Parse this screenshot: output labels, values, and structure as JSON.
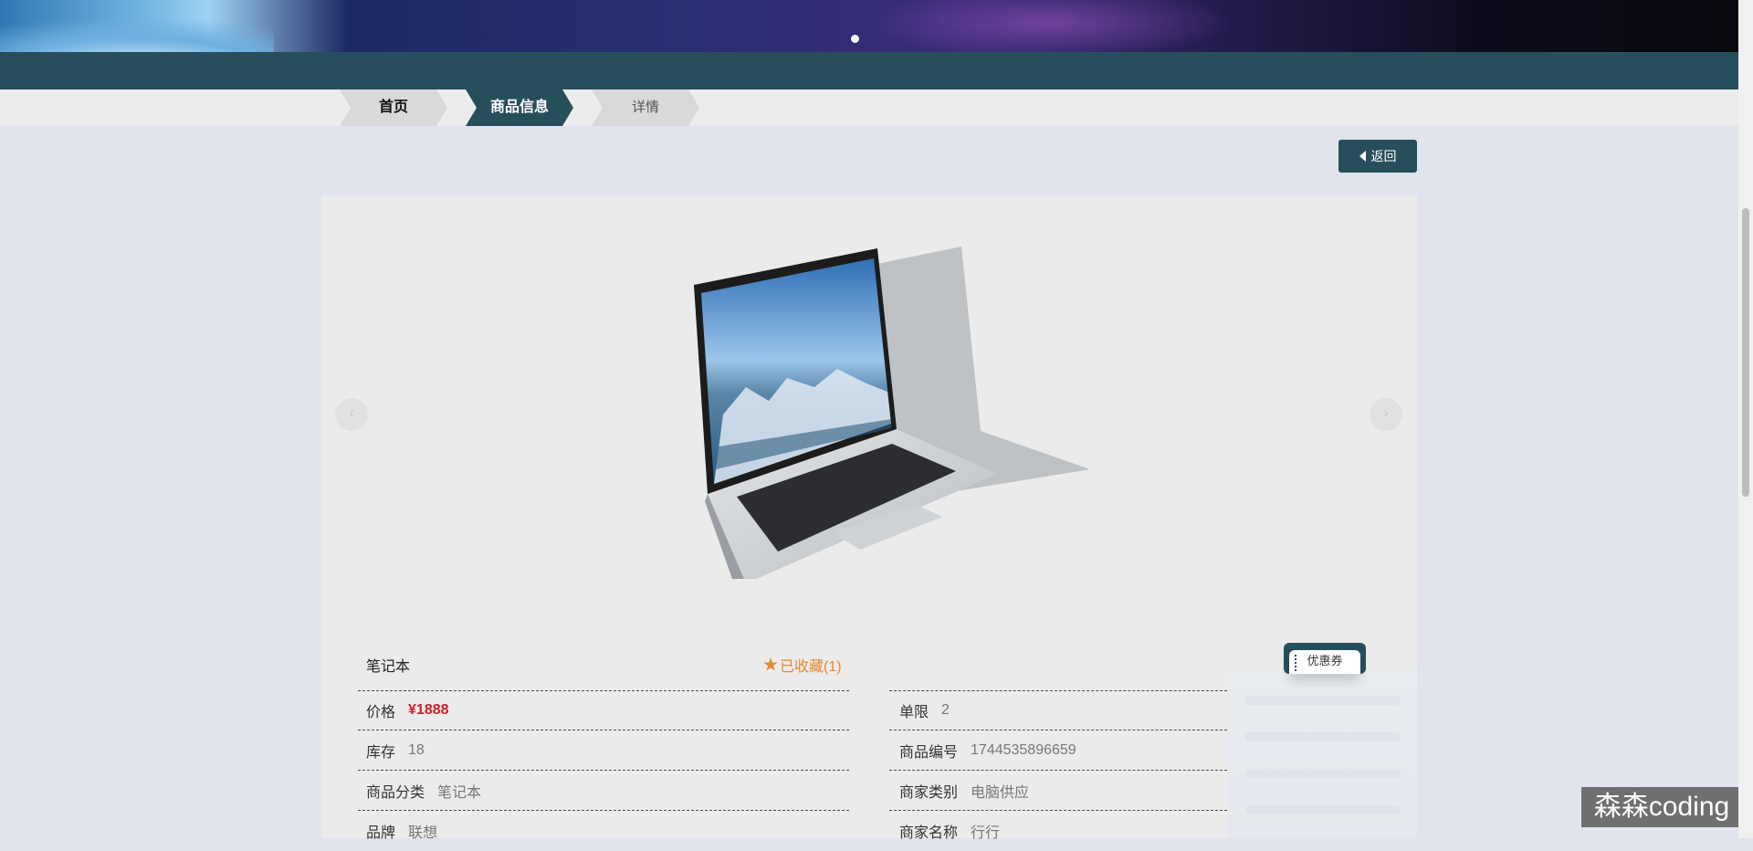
{
  "breadcrumb": {
    "home": "首页",
    "info": "商品信息",
    "detail": "详情"
  },
  "back_button": {
    "label": "返回"
  },
  "carousel": {
    "prev_symbol": "‹",
    "next_symbol": "›",
    "image_icon": "laptop-image"
  },
  "product": {
    "title": "笔记本",
    "favorite_label": "已收藏(1)",
    "coupon_label": "优惠券",
    "fields": {
      "price_label": "价格",
      "price_value": "¥1888",
      "limit_label": "单限",
      "limit_value": "2",
      "stock_label": "库存",
      "stock_value": "18",
      "code_label": "商品编号",
      "code_value": "1744535896659",
      "category_label": "商品分类",
      "category_value": "笔记本",
      "merchant_type_label": "商家类别",
      "merchant_type_value": "电脑供应",
      "brand_label": "品牌",
      "brand_value": "联想",
      "merchant_name_label": "商家名称",
      "merchant_name_value": "行行"
    }
  },
  "watermark": {
    "text": "森森coding"
  },
  "colors": {
    "accent": "#274f5b",
    "price": "#c8202a",
    "favorite": "#e5882c",
    "background": "#e1e4ec"
  }
}
